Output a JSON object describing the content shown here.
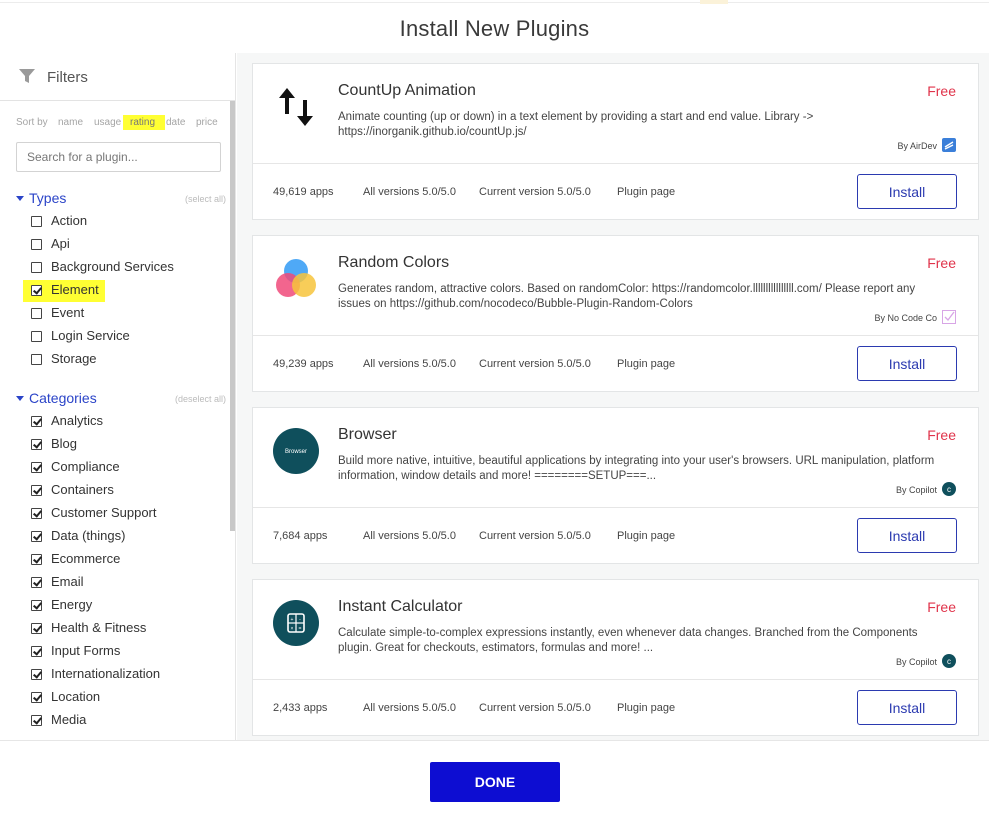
{
  "title": "Install New Plugins",
  "sidebar": {
    "filters_label": "Filters",
    "sort": {
      "label": "Sort by",
      "options": [
        "name",
        "usage",
        "rating",
        "date",
        "price"
      ],
      "selected": "rating"
    },
    "search": {
      "placeholder": "Search for a plugin...",
      "value": ""
    },
    "types": {
      "title": "Types",
      "action": "(select all)",
      "items": [
        {
          "label": "Action",
          "checked": false
        },
        {
          "label": "Api",
          "checked": false
        },
        {
          "label": "Background Services",
          "checked": false
        },
        {
          "label": "Element",
          "checked": true
        },
        {
          "label": "Event",
          "checked": false
        },
        {
          "label": "Login Service",
          "checked": false
        },
        {
          "label": "Storage",
          "checked": false
        }
      ]
    },
    "categories": {
      "title": "Categories",
      "action": "(deselect all)",
      "items": [
        {
          "label": "Analytics",
          "checked": true
        },
        {
          "label": "Blog",
          "checked": true
        },
        {
          "label": "Compliance",
          "checked": true
        },
        {
          "label": "Containers",
          "checked": true
        },
        {
          "label": "Customer Support",
          "checked": true
        },
        {
          "label": "Data (things)",
          "checked": true
        },
        {
          "label": "Ecommerce",
          "checked": true
        },
        {
          "label": "Email",
          "checked": true
        },
        {
          "label": "Energy",
          "checked": true
        },
        {
          "label": "Health & Fitness",
          "checked": true
        },
        {
          "label": "Input Forms",
          "checked": true
        },
        {
          "label": "Internationalization",
          "checked": true
        },
        {
          "label": "Location",
          "checked": true
        },
        {
          "label": "Media",
          "checked": true
        }
      ]
    }
  },
  "plugins": [
    {
      "name": "CountUp Animation",
      "price": "Free",
      "description": "Animate counting (up or down) in a text element by providing a start and end value. Library -> https://inorganik.github.io/countUp.js/",
      "author": "By AirDev",
      "apps": "49,619 apps",
      "all_versions": "All versions 5.0/5.0",
      "current_version": "Current version 5.0/5.0",
      "plugin_page": "Plugin page",
      "install_label": "Install",
      "logo": "up-down-arrows-icon",
      "author_icon": "airdev-icon"
    },
    {
      "name": "Random Colors",
      "price": "Free",
      "description": "Generates random, attractive colors. Based on randomColor: https://randomcolor.llllllllllllllll.com/ Please report any issues on https://github.com/nocodeco/Bubble-Plugin-Random-Colors",
      "author": "By No Code Co",
      "apps": "49,239 apps",
      "all_versions": "All versions 5.0/5.0",
      "current_version": "Current version 5.0/5.0",
      "plugin_page": "Plugin page",
      "install_label": "Install",
      "logo": "color-circles-icon",
      "author_icon": "nocodeco-icon"
    },
    {
      "name": "Browser",
      "price": "Free",
      "description": "Build more native, intuitive, beautiful applications by integrating into your user's browsers. URL manipulation, platform information, window details and more! ========SETUP===...",
      "author": "By Copilot",
      "apps": "7,684 apps",
      "all_versions": "All versions 5.0/5.0",
      "current_version": "Current version 5.0/5.0",
      "plugin_page": "Plugin page",
      "install_label": "Install",
      "logo": "browser-badge-icon",
      "logo_text": "Browser",
      "author_icon": "copilot-icon"
    },
    {
      "name": "Instant Calculator",
      "price": "Free",
      "description": "Calculate simple-to-complex expressions instantly, even whenever data changes. Branched from the Components plugin. Great for checkouts, estimators, formulas and more! ...",
      "author": "By Copilot",
      "apps": "2,433 apps",
      "all_versions": "All versions 5.0/5.0",
      "current_version": "Current version 5.0/5.0",
      "plugin_page": "Plugin page",
      "install_label": "Install",
      "logo": "calculator-icon",
      "author_icon": "copilot-icon"
    }
  ],
  "done_label": "DONE",
  "colors": {
    "accent": "#2b44c8",
    "price": "#e0344b",
    "done_button": "#0d0dd2",
    "highlight": "#ffff33",
    "logo_teal": "#0f4f5c"
  }
}
